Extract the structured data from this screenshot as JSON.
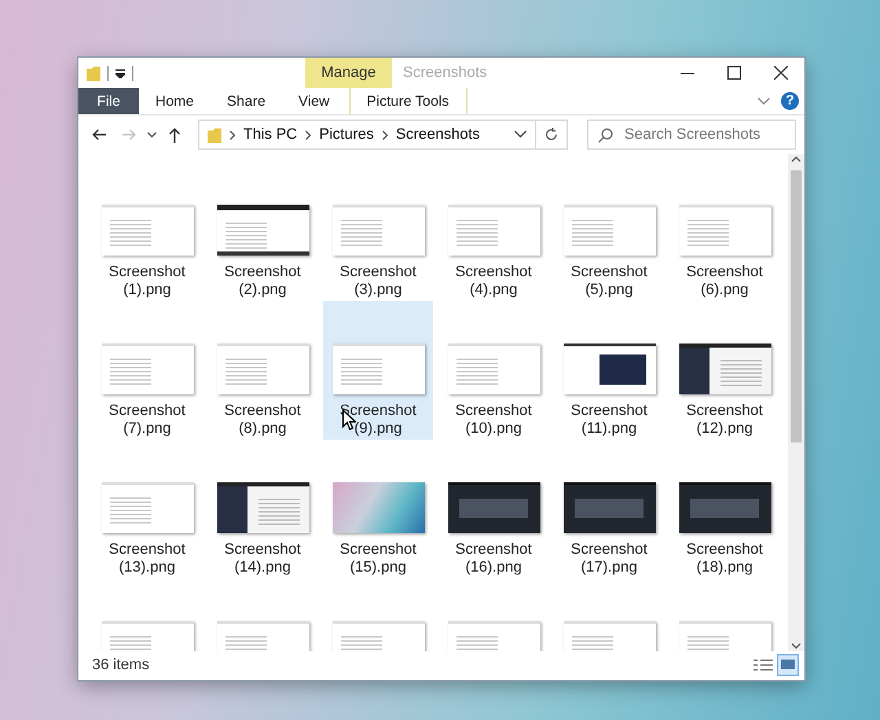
{
  "window": {
    "title": "Screenshots",
    "contextual_tab": "Manage"
  },
  "ribbon": {
    "tabs": [
      {
        "label": "File",
        "kind": "file"
      },
      {
        "label": "Home",
        "kind": "plain"
      },
      {
        "label": "Share",
        "kind": "plain"
      },
      {
        "label": "View",
        "kind": "plain"
      },
      {
        "label": "Picture Tools",
        "kind": "contextual"
      }
    ],
    "help": "?"
  },
  "navigation": {
    "buttons": [
      {
        "kind": "back",
        "disabled": false
      },
      {
        "kind": "forward",
        "disabled": true
      }
    ],
    "path": [
      "This PC",
      "Pictures",
      "Screenshots"
    ],
    "search": {
      "placeholder": "Search Screenshots"
    }
  },
  "files": [
    {
      "name": "Screenshot (1).png",
      "kind": "light",
      "selected": false
    },
    {
      "name": "Screenshot (2).png",
      "kind": "banded",
      "selected": false
    },
    {
      "name": "Screenshot (3).png",
      "kind": "light",
      "selected": false
    },
    {
      "name": "Screenshot (4).png",
      "kind": "light",
      "selected": false
    },
    {
      "name": "Screenshot (5).png",
      "kind": "light",
      "selected": false
    },
    {
      "name": "Screenshot (6).png",
      "kind": "light",
      "selected": false
    },
    {
      "name": "Screenshot (7).png",
      "kind": "light",
      "selected": false
    },
    {
      "name": "Screenshot (8).png",
      "kind": "light",
      "selected": false
    },
    {
      "name": "Screenshot (9).png",
      "kind": "light",
      "selected": true
    },
    {
      "name": "Screenshot (10).png",
      "kind": "light",
      "selected": false
    },
    {
      "name": "Screenshot (11).png",
      "kind": "mixed",
      "selected": false
    },
    {
      "name": "Screenshot (12).png",
      "kind": "sidebar",
      "selected": false
    },
    {
      "name": "Screenshot (13).png",
      "kind": "light",
      "selected": false
    },
    {
      "name": "Screenshot (14).png",
      "kind": "sidebar",
      "selected": false
    },
    {
      "name": "Screenshot (15).png",
      "kind": "photo",
      "selected": false
    },
    {
      "name": "Screenshot (16).png",
      "kind": "dark",
      "selected": false
    },
    {
      "name": "Screenshot (17).png",
      "kind": "dark",
      "selected": false
    },
    {
      "name": "Screenshot (18).png",
      "kind": "dark",
      "selected": false
    },
    {
      "kind": "light",
      "selected": false
    },
    {
      "kind": "light",
      "selected": false
    },
    {
      "kind": "light",
      "selected": false
    },
    {
      "kind": "light",
      "selected": false
    },
    {
      "kind": "light",
      "selected": false
    },
    {
      "kind": "light",
      "selected": false
    }
  ],
  "status_bar": {
    "item_count": "36 items"
  }
}
